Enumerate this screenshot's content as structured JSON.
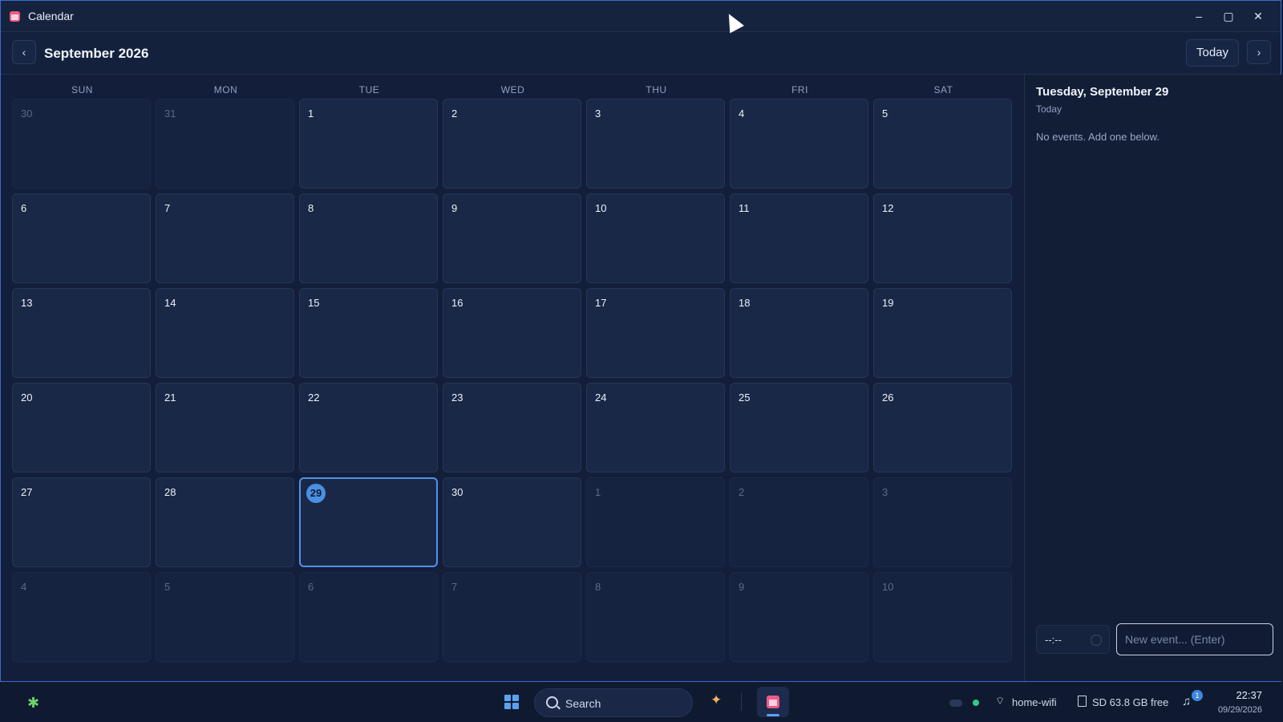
{
  "window": {
    "title": "Calendar",
    "controls": {
      "minimize": "–",
      "maximize": "▢",
      "close": "✕"
    }
  },
  "toolbar": {
    "prev": "‹",
    "month_title": "September 2026",
    "today_label": "Today",
    "next": "›"
  },
  "weekdays": [
    "SUN",
    "MON",
    "TUE",
    "WED",
    "THU",
    "FRI",
    "SAT"
  ],
  "weeks": [
    [
      {
        "day": "30",
        "other": true
      },
      {
        "day": "31",
        "other": true
      },
      {
        "day": "1"
      },
      {
        "day": "2"
      },
      {
        "day": "3"
      },
      {
        "day": "4"
      },
      {
        "day": "5"
      }
    ],
    [
      {
        "day": "6"
      },
      {
        "day": "7"
      },
      {
        "day": "8"
      },
      {
        "day": "9"
      },
      {
        "day": "10"
      },
      {
        "day": "11"
      },
      {
        "day": "12"
      }
    ],
    [
      {
        "day": "13"
      },
      {
        "day": "14"
      },
      {
        "day": "15"
      },
      {
        "day": "16"
      },
      {
        "day": "17"
      },
      {
        "day": "18"
      },
      {
        "day": "19"
      }
    ],
    [
      {
        "day": "20"
      },
      {
        "day": "21"
      },
      {
        "day": "22"
      },
      {
        "day": "23"
      },
      {
        "day": "24"
      },
      {
        "day": "25"
      },
      {
        "day": "26"
      }
    ],
    [
      {
        "day": "27"
      },
      {
        "day": "28"
      },
      {
        "day": "29",
        "today": true,
        "selected": true
      },
      {
        "day": "30"
      },
      {
        "day": "1",
        "other": true
      },
      {
        "day": "2",
        "other": true
      },
      {
        "day": "3",
        "other": true
      }
    ],
    [
      {
        "day": "4",
        "other": true
      },
      {
        "day": "5",
        "other": true
      },
      {
        "day": "6",
        "other": true
      },
      {
        "day": "7",
        "other": true
      },
      {
        "day": "8",
        "other": true
      },
      {
        "day": "9",
        "other": true
      },
      {
        "day": "10",
        "other": true
      }
    ]
  ],
  "side_panel": {
    "date_heading": "Tuesday, September 29",
    "subtitle": "Today",
    "empty_message": "No events. Add one below.",
    "time_value": "--:--",
    "event_placeholder": "New event... (Enter)"
  },
  "taskbar": {
    "search_label": "Search",
    "wifi_label": "home-wifi",
    "storage_label": "SD 63.8 GB free",
    "notification_count": "1",
    "time": "22:37",
    "date": "09/29/2026"
  },
  "colors": {
    "accent": "#4a90e2",
    "today_border": "#4f94e6",
    "app_icon": "#f05a86"
  },
  "icons": {
    "app": "calendar-icon",
    "search": "search-icon",
    "wifi": "wifi-icon",
    "storage": "sd-card-icon",
    "notifications": "bell-icon",
    "copilot": "sparkle-icon",
    "start": "windows-start-icon",
    "widgets": "puzzle-icon"
  }
}
